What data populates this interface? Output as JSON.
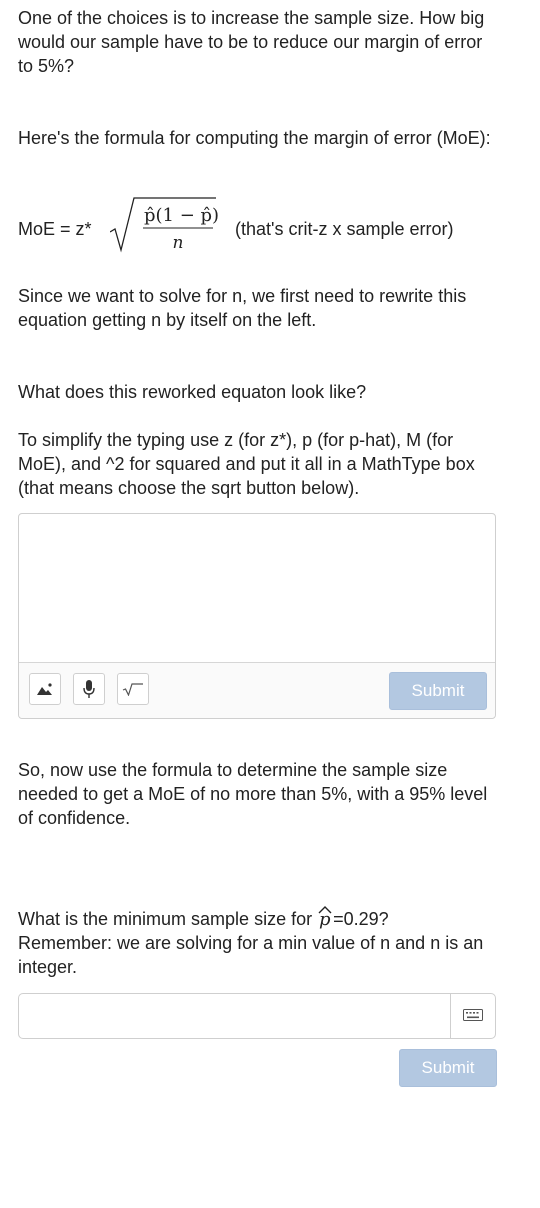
{
  "intro": {
    "text": "One of the choices is to increase the sample size.  How big would our sample have to be to reduce our margin of error to 5%?"
  },
  "formula_intro": {
    "text": "Here's the formula for computing the margin of error (MoE):"
  },
  "formula": {
    "lhs": "MoE = z*",
    "numerator": "p̂(1 − p̂)",
    "denominator": "n",
    "note": "(that's crit-z x sample error)"
  },
  "solve_text": {
    "text": "Since we want to solve for n, we first need to rewrite this equation getting n by itself on the left."
  },
  "question1": {
    "text": "What does this reworked equaton look like?"
  },
  "instructions": {
    "text": "To simplify the typing use z (for z*), p (for p-hat), M (for MoE), and ^2 for squared and put it all in a MathType box (that means choose the sqrt button below)."
  },
  "answer1": {
    "value": "",
    "submit_label": "Submit",
    "tools": [
      "image-icon",
      "microphone-icon",
      "sqrt-icon"
    ]
  },
  "part2": {
    "text": "So, now use the formula to determine the sample size needed to get a MoE of no more than 5%, with a 95% level of confidence."
  },
  "question2": {
    "before": "What is the minimum sample size for ",
    "symbol": "p",
    "after": "=0.29?",
    "reminder": "Remember: we are solving for a min value of n and n is an integer."
  },
  "answer2": {
    "value": "",
    "submit_label": "Submit"
  },
  "colors": {
    "submit_disabled": "#b3c8e1",
    "border": "#cfcfcf",
    "text": "#222222"
  }
}
